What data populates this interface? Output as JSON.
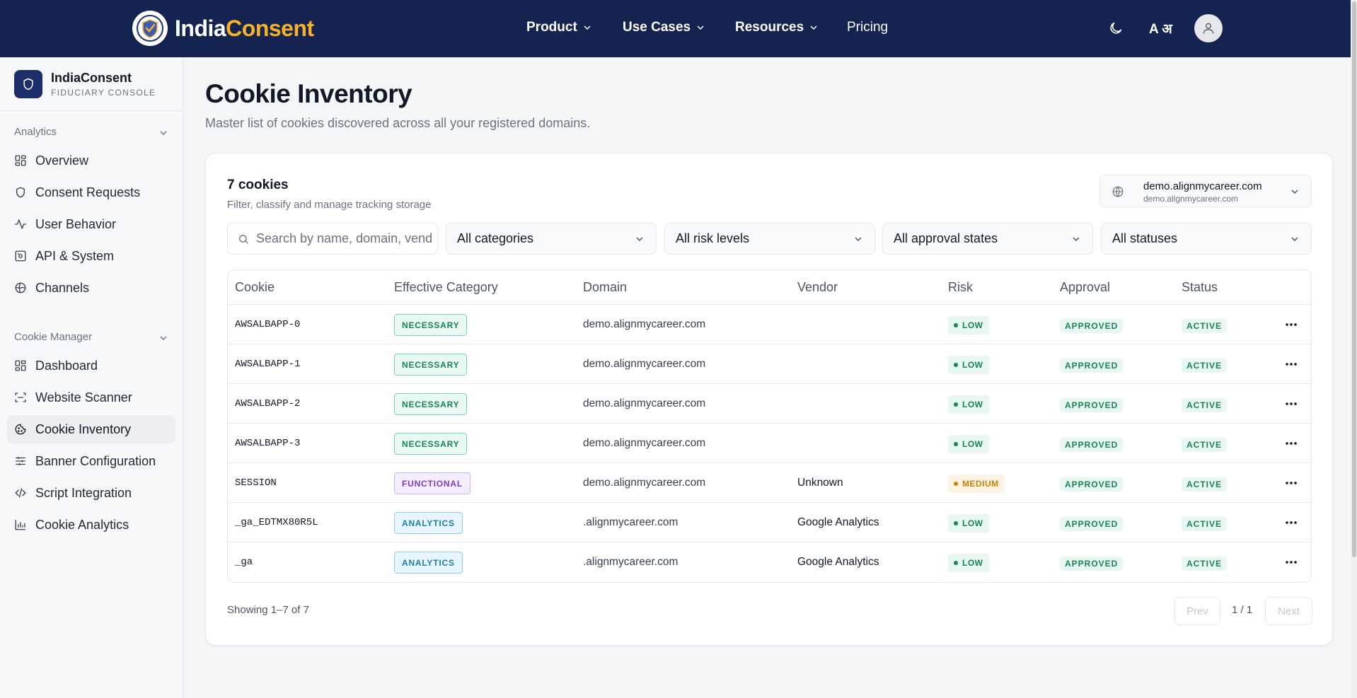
{
  "brand": {
    "part1": "India",
    "part2": "Consent"
  },
  "nav": {
    "product": "Product",
    "use_cases": "Use Cases",
    "resources": "Resources",
    "pricing": "Pricing",
    "lang": "A अ"
  },
  "sidebar": {
    "title": "IndiaConsent",
    "subtitle": "FIDUCIARY CONSOLE",
    "section_analytics": "Analytics",
    "analytics_items": [
      "Overview",
      "Consent Requests",
      "User Behavior",
      "API & System",
      "Channels"
    ],
    "section_cookie": "Cookie Manager",
    "cookie_items": [
      "Dashboard",
      "Website Scanner",
      "Cookie Inventory",
      "Banner Configuration",
      "Script Integration",
      "Cookie Analytics"
    ],
    "active_item": "Cookie Inventory"
  },
  "page": {
    "title": "Cookie Inventory",
    "description": "Master list of cookies discovered across all your registered domains."
  },
  "card": {
    "count": "7 cookies",
    "subtitle": "Filter, classify and manage tracking storage",
    "domain_selected": "demo.alignmycareer.com",
    "domain_sub": "demo.alignmycareer.com"
  },
  "filters": {
    "search_placeholder": "Search by name, domain, vendor",
    "category": "All categories",
    "risk": "All risk levels",
    "approval": "All approval states",
    "status": "All statuses"
  },
  "table": {
    "headers": {
      "cookie": "Cookie",
      "category": "Effective Category",
      "domain": "Domain",
      "vendor": "Vendor",
      "risk": "Risk",
      "approval": "Approval",
      "status": "Status"
    },
    "rows": [
      {
        "cookie": "AWSALBAPP-0",
        "category": "NECESSARY",
        "domain": "demo.alignmycareer.com",
        "vendor": "",
        "risk": "LOW",
        "approval": "APPROVED",
        "status": "ACTIVE"
      },
      {
        "cookie": "AWSALBAPP-1",
        "category": "NECESSARY",
        "domain": "demo.alignmycareer.com",
        "vendor": "",
        "risk": "LOW",
        "approval": "APPROVED",
        "status": "ACTIVE"
      },
      {
        "cookie": "AWSALBAPP-2",
        "category": "NECESSARY",
        "domain": "demo.alignmycareer.com",
        "vendor": "",
        "risk": "LOW",
        "approval": "APPROVED",
        "status": "ACTIVE"
      },
      {
        "cookie": "AWSALBAPP-3",
        "category": "NECESSARY",
        "domain": "demo.alignmycareer.com",
        "vendor": "",
        "risk": "LOW",
        "approval": "APPROVED",
        "status": "ACTIVE"
      },
      {
        "cookie": "SESSION",
        "category": "FUNCTIONAL",
        "domain": "demo.alignmycareer.com",
        "vendor": "Unknown",
        "risk": "MEDIUM",
        "approval": "APPROVED",
        "status": "ACTIVE"
      },
      {
        "cookie": "_ga_EDTMX80R5L",
        "category": "ANALYTICS",
        "domain": ".alignmycareer.com",
        "vendor": "Google Analytics",
        "risk": "LOW",
        "approval": "APPROVED",
        "status": "ACTIVE"
      },
      {
        "cookie": "_ga",
        "category": "ANALYTICS",
        "domain": ".alignmycareer.com",
        "vendor": "Google Analytics",
        "risk": "LOW",
        "approval": "APPROVED",
        "status": "ACTIVE"
      }
    ]
  },
  "pagination": {
    "showing": "Showing 1–7 of 7",
    "prev": "Prev",
    "page": "1 / 1",
    "next": "Next"
  },
  "colors": {
    "topbar": "#142350",
    "brand_accent": "#f5b228",
    "necessary": "#17845a",
    "functional": "#7e3ccf",
    "analytics": "#1a7fab",
    "medium": "#c9820d"
  }
}
